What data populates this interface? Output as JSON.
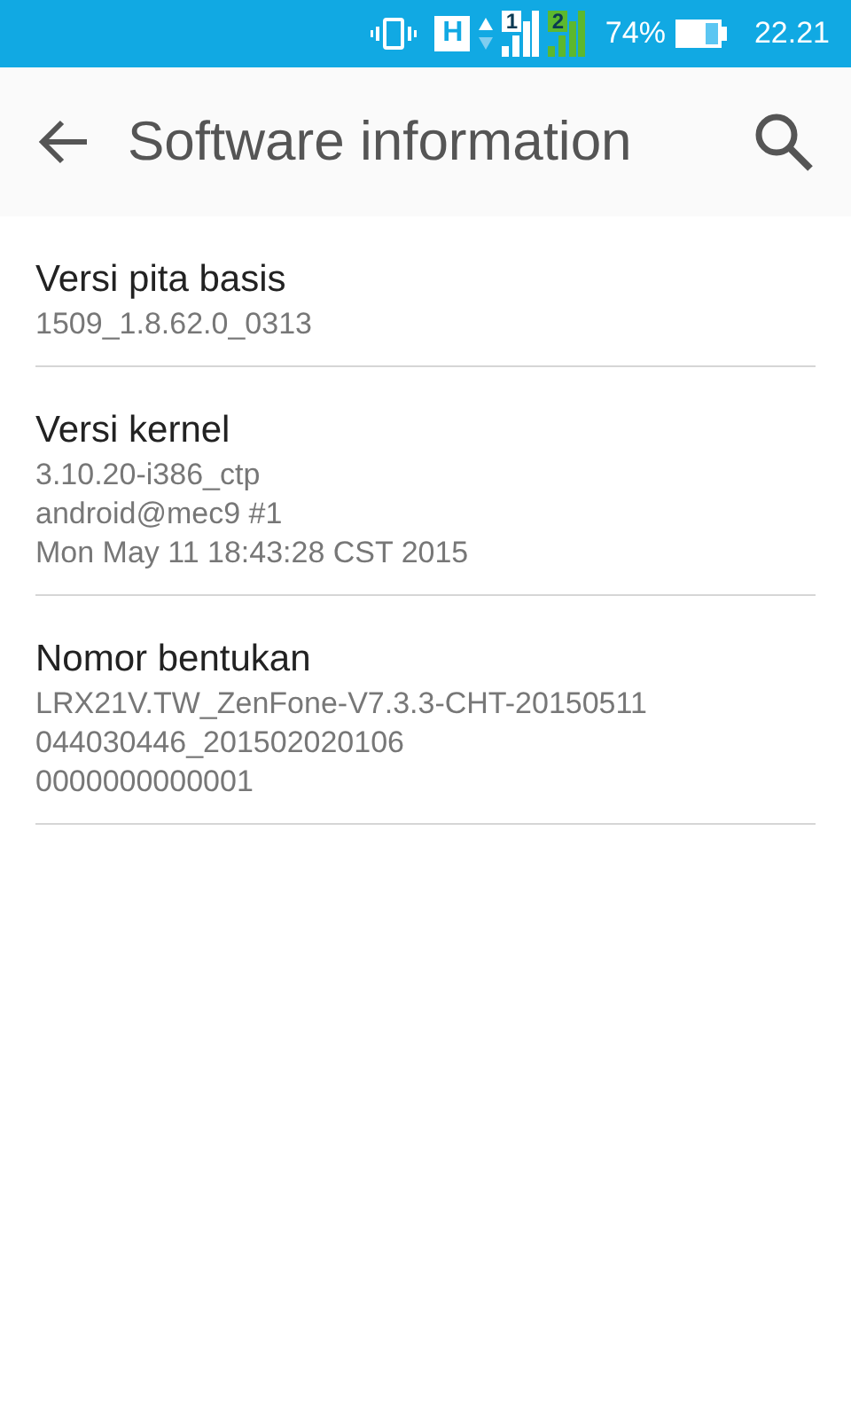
{
  "status_bar": {
    "network": "H",
    "sims": [
      {
        "label": "1",
        "color": "#ffffff"
      },
      {
        "label": "2",
        "color": "#5cb82e"
      }
    ],
    "battery": "74%",
    "time": "22.21"
  },
  "app_bar": {
    "title": "Software information"
  },
  "items": [
    {
      "title": "Versi pita basis",
      "lines": [
        "1509_1.8.62.0_0313"
      ]
    },
    {
      "title": "Versi kernel",
      "lines": [
        "3.10.20-i386_ctp",
        "android@mec9 #1",
        "Mon May 11 18:43:28 CST 2015"
      ]
    },
    {
      "title": "Nomor bentukan",
      "lines": [
        "LRX21V.TW_ZenFone-V7.3.3-CHT-20150511",
        "044030446_201502020106",
        "0000000000001"
      ]
    }
  ]
}
